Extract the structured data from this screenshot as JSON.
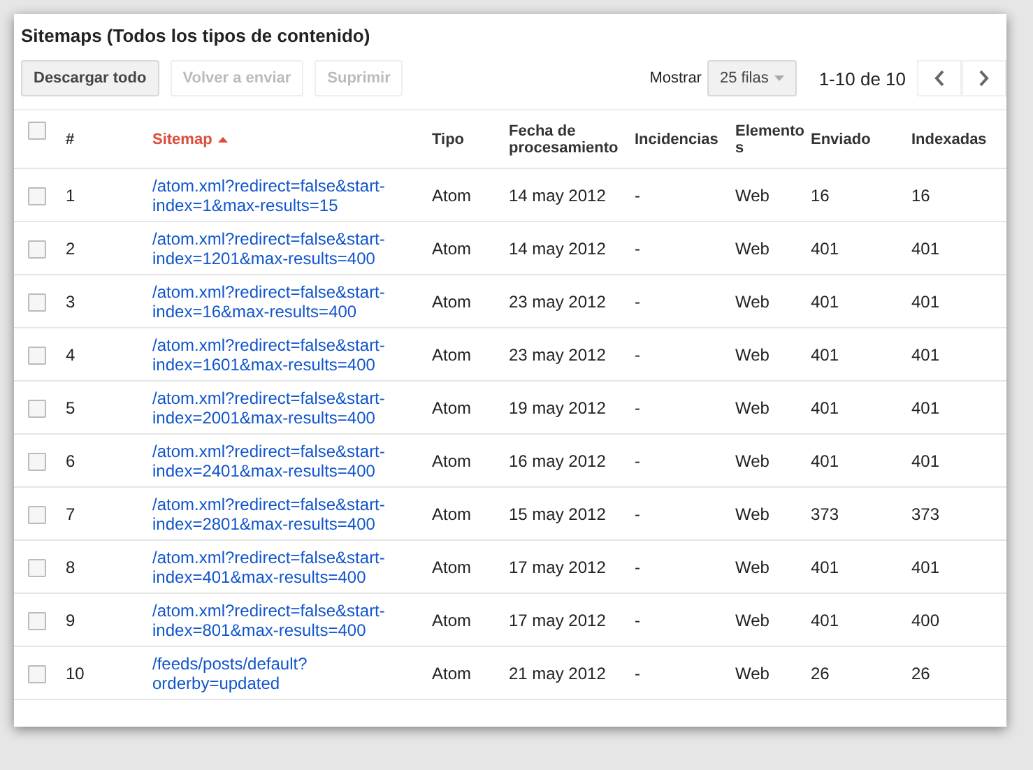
{
  "title": "Sitemaps (Todos los tipos de contenido)",
  "toolbar": {
    "buttons": [
      {
        "label": "Descargar todo",
        "disabled": false
      },
      {
        "label": "Volver a enviar",
        "disabled": true
      },
      {
        "label": "Suprimir",
        "disabled": true
      }
    ],
    "show_label": "Mostrar",
    "rows_dropdown": "25 filas",
    "pagination": "1-10 de 10"
  },
  "table": {
    "select_all_checked": false,
    "columns": [
      {
        "label": "#",
        "sorted": false
      },
      {
        "label": "Sitemap",
        "sorted": true
      },
      {
        "label": "Tipo",
        "sorted": false
      },
      {
        "label": "Fecha de procesamiento",
        "sorted": false
      },
      {
        "label": "Incidencias",
        "sorted": false
      },
      {
        "label": "Elementos",
        "sorted": false
      },
      {
        "label": "Enviado",
        "sorted": false
      },
      {
        "label": "Indexadas",
        "sorted": false
      }
    ],
    "rows": [
      {
        "checked": false,
        "cells": [
          "1",
          "/atom.xml?redirect=false&start-index=1&max-results=15",
          "Atom",
          "14 may 2012",
          "-",
          "Web",
          "16",
          "16"
        ]
      },
      {
        "checked": false,
        "cells": [
          "2",
          "/atom.xml?redirect=false&start-index=1201&max-results=400",
          "Atom",
          "14 may 2012",
          "-",
          "Web",
          "401",
          "401"
        ]
      },
      {
        "checked": false,
        "cells": [
          "3",
          "/atom.xml?redirect=false&start-index=16&max-results=400",
          "Atom",
          "23 may 2012",
          "-",
          "Web",
          "401",
          "401"
        ]
      },
      {
        "checked": false,
        "cells": [
          "4",
          "/atom.xml?redirect=false&start-index=1601&max-results=400",
          "Atom",
          "23 may 2012",
          "-",
          "Web",
          "401",
          "401"
        ]
      },
      {
        "checked": false,
        "cells": [
          "5",
          "/atom.xml?redirect=false&start-index=2001&max-results=400",
          "Atom",
          "19 may 2012",
          "-",
          "Web",
          "401",
          "401"
        ]
      },
      {
        "checked": false,
        "cells": [
          "6",
          "/atom.xml?redirect=false&start-index=2401&max-results=400",
          "Atom",
          "16 may 2012",
          "-",
          "Web",
          "401",
          "401"
        ]
      },
      {
        "checked": false,
        "cells": [
          "7",
          "/atom.xml?redirect=false&start-index=2801&max-results=400",
          "Atom",
          "15 may 2012",
          "-",
          "Web",
          "373",
          "373"
        ]
      },
      {
        "checked": false,
        "cells": [
          "8",
          "/atom.xml?redirect=false&start-index=401&max-results=400",
          "Atom",
          "17 may 2012",
          "-",
          "Web",
          "401",
          "401"
        ]
      },
      {
        "checked": false,
        "cells": [
          "9",
          "/atom.xml?redirect=false&start-index=801&max-results=400",
          "Atom",
          "17 may 2012",
          "-",
          "Web",
          "401",
          "400"
        ]
      },
      {
        "checked": false,
        "cells": [
          "10",
          "/feeds/posts/default?\norderby=updated",
          "Atom",
          "21 may 2012",
          "-",
          "Web",
          "26",
          "26"
        ]
      }
    ]
  }
}
